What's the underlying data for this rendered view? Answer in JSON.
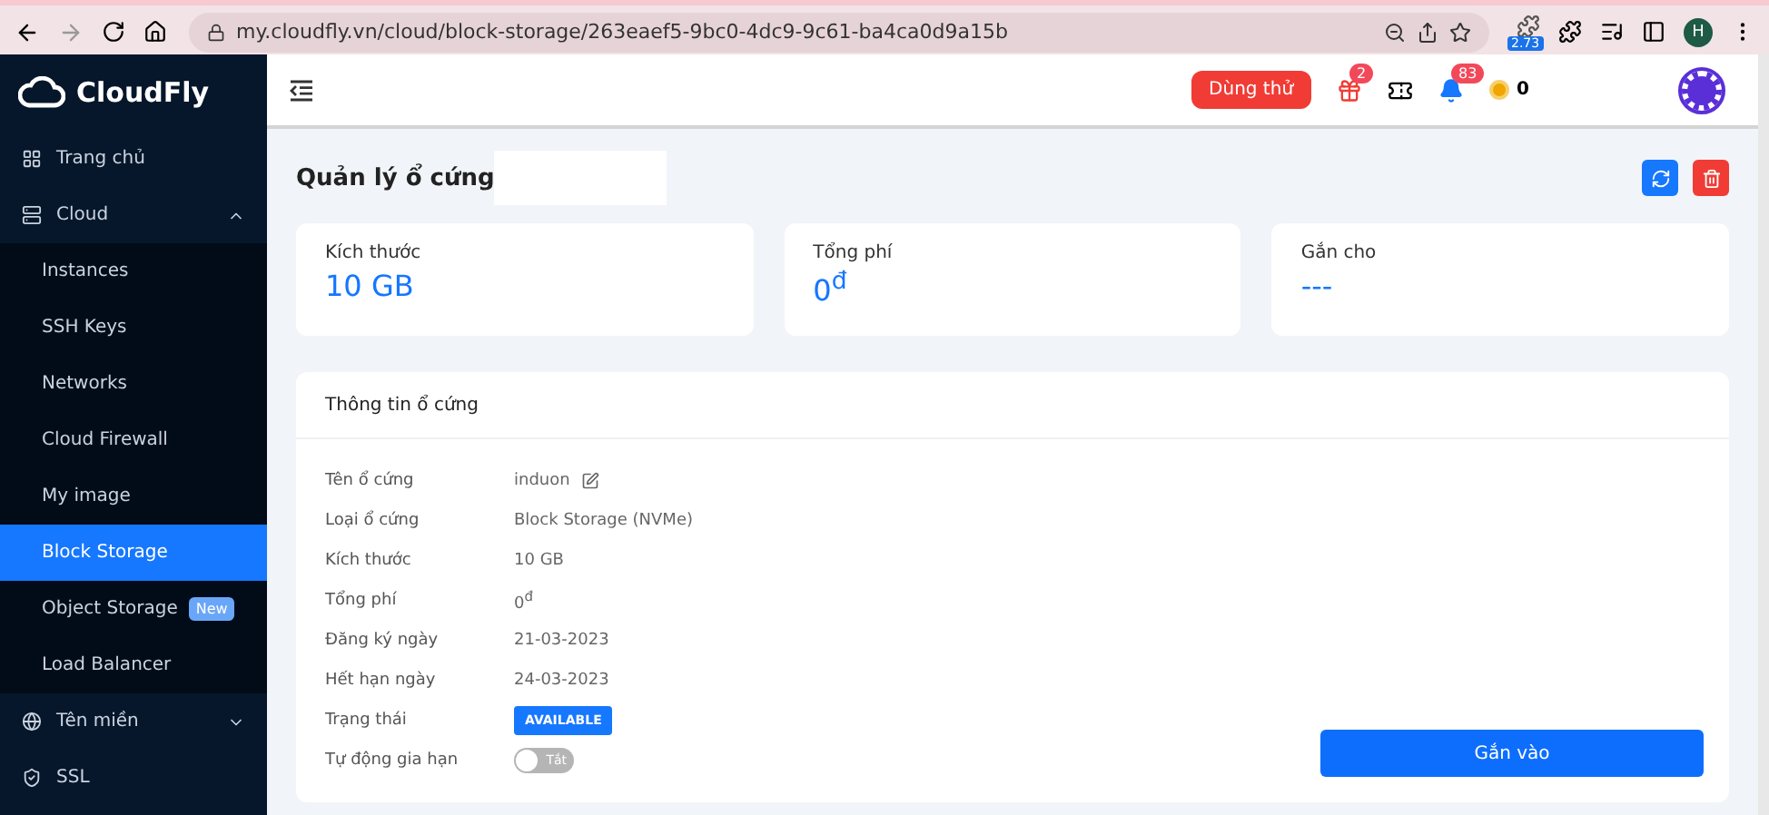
{
  "browser": {
    "url": "my.cloudfly.vn/cloud/block-storage/263eaef5-9bc0-4dc9-9c61-ba4ca0d9a15b",
    "extension_badge": "2.73",
    "profile": "H",
    "forward_disabled": true
  },
  "sidebar": {
    "logo": "CloudFly",
    "items": [
      {
        "kind": "section",
        "label": "Trang chủ",
        "selected": false
      },
      {
        "kind": "section",
        "label": "Cloud",
        "selected": false,
        "expanded": true
      },
      {
        "kind": "sub",
        "label": "Instances",
        "selected": false
      },
      {
        "kind": "sub",
        "label": "SSH Keys",
        "selected": false
      },
      {
        "kind": "sub",
        "label": "Networks",
        "selected": false
      },
      {
        "kind": "sub",
        "label": "Cloud Firewall",
        "selected": false
      },
      {
        "kind": "sub",
        "label": "My image",
        "selected": false
      },
      {
        "kind": "sub",
        "label": "Block Storage",
        "selected": true
      },
      {
        "kind": "sub",
        "label": "Object Storage",
        "badge": "New",
        "selected": false
      },
      {
        "kind": "sub",
        "label": "Load Balancer",
        "selected": false
      },
      {
        "kind": "section",
        "label": "Tên miền",
        "selected": false,
        "expanded": false
      },
      {
        "kind": "section",
        "label": "SSL",
        "selected": false
      }
    ]
  },
  "header": {
    "trial_button": "Dùng thử",
    "gift_count": "2",
    "notification_count": "83",
    "coins": "0"
  },
  "page": {
    "title": "Quản lý ổ cứng"
  },
  "stats": [
    {
      "label": "Kích thước",
      "value": "10 GB"
    },
    {
      "label": "Tổng phí",
      "value": "0$^{đ}$"
    },
    {
      "label": "Gắn cho",
      "value": "---"
    }
  ],
  "details": {
    "title": "Thông tin ổ cứng",
    "rows": [
      {
        "kind": "editable",
        "label": "Tên ổ cứng",
        "value": "induon"
      },
      {
        "kind": "text",
        "label": "Loại ổ cứng",
        "value": "Block Storage (NVMe)"
      },
      {
        "kind": "text",
        "label": "Kích thước",
        "value": "10 GB"
      },
      {
        "kind": "text",
        "label": "Tổng phí",
        "value": "0$^{đ}$"
      },
      {
        "kind": "text",
        "label": "Đăng ký ngày",
        "value": "21-03-2023"
      },
      {
        "kind": "text",
        "label": "Hết hạn ngày",
        "value": "24-03-2023"
      },
      {
        "kind": "status",
        "label": "Trạng thái",
        "value": "AVAILABLE"
      },
      {
        "kind": "toggle",
        "label": "Tự động gia hạn",
        "value": "Tắt",
        "on": false
      }
    ],
    "attach_button": "Gắn vào"
  }
}
